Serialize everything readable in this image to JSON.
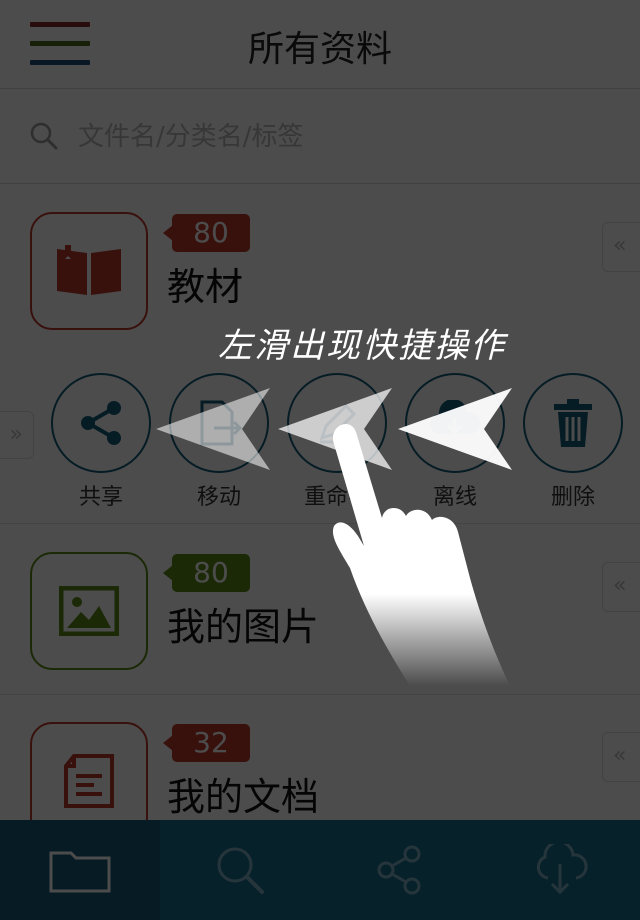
{
  "header": {
    "title": "所有资料"
  },
  "menu_colors": [
    "#8b2b2b",
    "#4a6b1f",
    "#1f4f7a"
  ],
  "search": {
    "placeholder": "文件名/分类名/标签"
  },
  "categories": [
    {
      "name": "教材",
      "count": "80",
      "icon": "book-icon",
      "color": "#c0392b"
    },
    {
      "name": "我的图片",
      "count": "80",
      "icon": "image-icon",
      "color": "#5a8a16"
    },
    {
      "name": "我的文档",
      "count": "32",
      "icon": "document-icon",
      "color": "#c0392b"
    }
  ],
  "actions": [
    {
      "label": "共享",
      "icon": "share-icon"
    },
    {
      "label": "移动",
      "icon": "move-file-icon"
    },
    {
      "label": "重命名",
      "icon": "rename-icon"
    },
    {
      "label": "离线",
      "icon": "offline-download-icon"
    },
    {
      "label": "删除",
      "icon": "trash-icon"
    }
  ],
  "hint": "左滑出现快捷操作",
  "chevron_glyph": "«",
  "left_chevron_glyph": "»",
  "tabs": [
    {
      "name": "files",
      "icon": "folder-icon"
    },
    {
      "name": "search",
      "icon": "search-icon"
    },
    {
      "name": "share",
      "icon": "share-icon"
    },
    {
      "name": "offline",
      "icon": "cloud-download-icon"
    }
  ],
  "accent": "#1a6e8e"
}
